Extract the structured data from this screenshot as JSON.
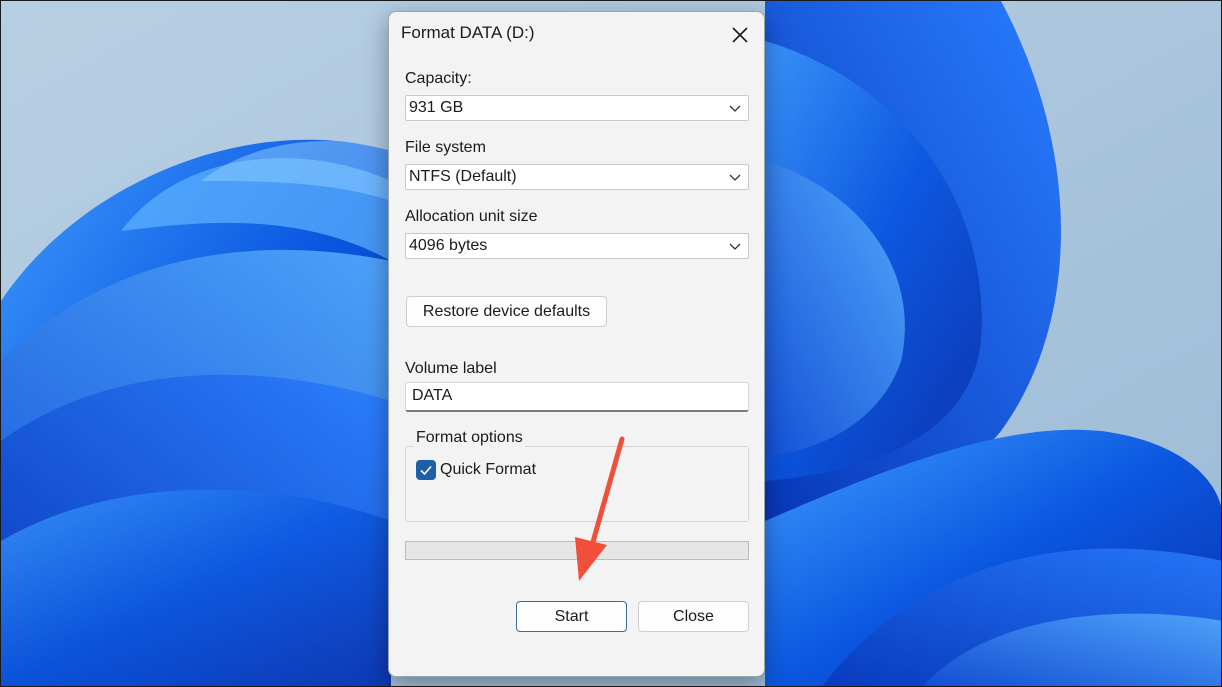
{
  "dialog": {
    "title": "Format DATA (D:)",
    "close_icon": "close-x-icon"
  },
  "capacity": {
    "label": "Capacity:",
    "value": "931 GB"
  },
  "file_system": {
    "label": "File system",
    "value": "NTFS (Default)"
  },
  "allocation": {
    "label": "Allocation unit size",
    "value": "4096 bytes"
  },
  "restore_button": {
    "label": "Restore device defaults"
  },
  "volume": {
    "label": "Volume label",
    "value": "DATA"
  },
  "format_options": {
    "legend": "Format options",
    "quick_format_label": "Quick Format",
    "quick_format_checked": true
  },
  "progress": {
    "fraction": 0
  },
  "buttons": {
    "start": "Start",
    "close": "Close"
  },
  "colors": {
    "accent": "#1f5fa8",
    "annotation_arrow": "#f0503a",
    "dialog_bg": "#f3f3f3"
  }
}
